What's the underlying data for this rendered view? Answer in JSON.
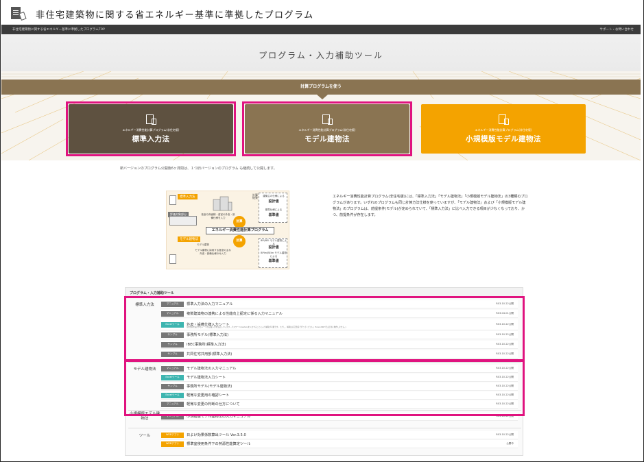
{
  "site": {
    "title": "非住宅建築物に関する省エネルギー基準に準拠したプログラム",
    "breadcrumb": "非住宅建築物に関する省エネルギー基準に準拠したプログラムTOP",
    "support_link": "サポート・お問い合わせ"
  },
  "page": {
    "heading": "プログラム・入力補助ツール"
  },
  "hero": {
    "band_label": "計算プログラムを使う",
    "cards": [
      {
        "sub": "エネルギー消費性能計算プログラム(非住宅版)",
        "title": "標準入力法",
        "color": "#5e5140"
      },
      {
        "sub": "エネルギー消費性能計算プログラム(非住宅版)",
        "title": "モデル建物法",
        "color": "#8a7452"
      },
      {
        "sub": "エネルギー消費性能計算プログラム(非住宅版)",
        "title": "小規模版モデル建物法",
        "color": "#f4a300"
      }
    ],
    "highlight_color": "#e0137f"
  },
  "note": "新バージョンのプログラム公開後6ヶ月間は、１つ旧バージョンのプログラム も継続して公開します。",
  "diagram": {
    "tag_standard": "標準入力法",
    "tag_model": "モデル建物法",
    "tag_floor": "評価対象部分",
    "floor_caption": "各室の床面積・各室の外皮・設備仕様を入力",
    "model_caption": "モデル建物に採用する各室の主な外皮・設備仕様のみ入力",
    "model_label": "モデル建物",
    "center": "エネルギー消費性能計算プログラム",
    "calc": "計算",
    "result_design": "設計値",
    "result_std": "基準値",
    "result_design_cap": "建築主の仕様による",
    "result_std_cap": "基準仕様による",
    "side_label": "計算結果",
    "bei_design": "設計値",
    "bei_std": "基準値",
    "bei_design_cap": "BPI/BEI モデル建物による",
    "bei_std_cap": "BPIm/BEIm モデル建物による"
  },
  "description": "エネルギー消費性能計算プログラム(非住宅版)には、「標準入力法」「モデル建物法」「小規模版モデル建物法」の3種類のプログラムがあります。いずれのプログラムも同じ計算方法仕様を使っていますが、「モデル建物法」および「小規模版モデル建物法」のプログラムは、前提条件(モデル)が定められていて、「標準入力法」に比べ入力できる項目が少なくなっており、かつ、前提条件が存在します。",
  "tools": {
    "heading": "プログラム・入力補助ツール",
    "badge_colors": {
      "manual": "#777777",
      "excel": "#3db5b0",
      "sample": "#777777",
      "web": "#f4a300"
    },
    "groups": [
      {
        "label": "標準入力法",
        "rows": [
          {
            "badge": "マニュアル",
            "type": "manual",
            "label": "標準入力法の入力マニュアル",
            "date": "R03.10.22公開"
          },
          {
            "badge": "マニュアル",
            "type": "manual",
            "label": "複数建築物の連携による性能向上認定に係る入力マニュアル",
            "date": "R03.04.01公開"
          },
          {
            "badge": "Excelツール",
            "type": "excel",
            "label": "外皮・設備仕様入力シート",
            "date": "R03.10.22公開",
            "desc": "(各仕様を集計するシートの記載入力を追記しています。パスワード(kantan)を入力することにより解除が可能です。ただし、解除は自己責任で行ってください。Excel 2007では正常に動作しません。)"
          },
          {
            "badge": "サンプル",
            "type": "sample",
            "label": "事務所モデル(標準入力法)",
            "date": "R03.10.22公開"
          },
          {
            "badge": "サンプル",
            "type": "sample",
            "label": "IBEC事務所(標準入力法)",
            "date": "R03.10.22公開"
          },
          {
            "badge": "サンプル",
            "type": "sample",
            "label": "共同住宅共用部(標準入力法)",
            "date": "R03.10.22公開"
          }
        ]
      },
      {
        "label": "モデル建物法",
        "rows": [
          {
            "badge": "マニュアル",
            "type": "manual",
            "label": "モデル建物法の入力マニュアル",
            "date": "R03.10.22公開"
          },
          {
            "badge": "Excelツール",
            "type": "excel",
            "label": "モデル建物法入力シート",
            "date": "R03.10.22公開"
          },
          {
            "badge": "サンプル",
            "type": "sample",
            "label": "事務所モデル(モデル建物法)",
            "date": "R03.10.22公開"
          },
          {
            "badge": "Excelツール",
            "type": "excel",
            "label": "軽微な変更用の確認シート",
            "date": "R03.10.22公開"
          },
          {
            "badge": "マニュアル",
            "type": "manual",
            "label": "軽微な変更の判断の仕方について",
            "date": "R03.10.22公開"
          }
        ]
      },
      {
        "label": "小規模版モデル建物法",
        "rows": [
          {
            "badge": "マニュアル",
            "type": "manual",
            "label": "小規模版モデル建物法の入力マニュアル",
            "date": "R03.10.22公開"
          }
        ]
      },
      {
        "label": "ツール",
        "rows": [
          {
            "badge": "WEBアプリ",
            "type": "web",
            "label": "日よけ効果係数算出ツール Ver.3.5.0",
            "date": "R03.10.22公開"
          },
          {
            "badge": "WEBアプリ",
            "type": "web",
            "label": "標準室使用条件下の熱源性能算定ツール",
            "date": "公開中"
          }
        ]
      }
    ]
  }
}
